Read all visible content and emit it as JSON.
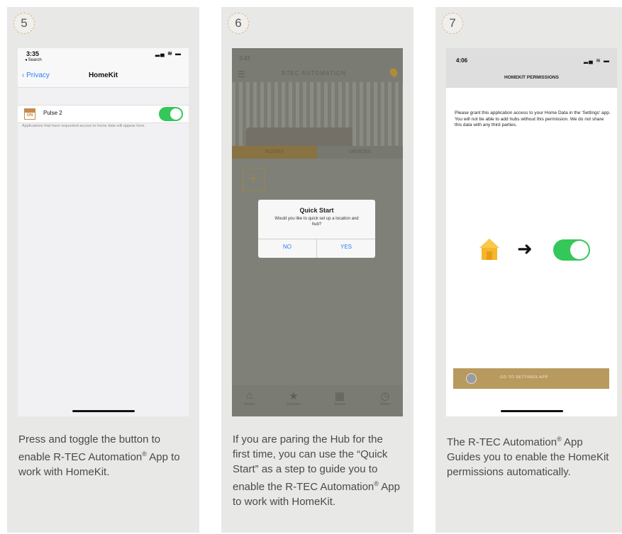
{
  "steps": [
    {
      "number": "5",
      "caption_parts": [
        "Press and toggle the button to enable R-TEC Automation",
        "®",
        " App to work with HomeKit."
      ]
    },
    {
      "number": "6",
      "caption_parts": [
        "If you are paring the Hub for the first time, you can use the “Quick Start” as a step to guide you to enable the R-TEC Automation",
        "®",
        " App to work with HomeKit."
      ]
    },
    {
      "number": "7",
      "caption_parts": [
        "The R-TEC Automation",
        "®",
        " App Guides you to enable the HomeKit permissions automatically."
      ]
    }
  ],
  "phone1": {
    "time": "3:35",
    "back_search": "◂ Search",
    "back_label": "Privacy",
    "title": "HomeKit",
    "app_icon_text": "ON",
    "app_name": "Pulse 2",
    "toggle_on": true,
    "note": "Applications that have requested access to home data will appear here."
  },
  "phone2": {
    "time": "3:43",
    "logo": "RTEC AUTOMATION",
    "tab_active": "ROOMS",
    "tab_inactive": "DEVICES",
    "dialog": {
      "title": "Quick Start",
      "message": "Would you like to quick set up a location and hub?",
      "no_label": "NO",
      "yes_label": "YES"
    },
    "nav": [
      "Rooms",
      "Favorites",
      "Scenes",
      "Timers"
    ]
  },
  "phone3": {
    "time": "4:06",
    "title": "HOMEKIT PERMISSIONS",
    "message": "Please grant this application access to your Home Data in the 'Settings' app. You will not be able to add hubs without this permission. We do not share this data with any third parties.",
    "button_label": "GO TO SETTINGS APP"
  },
  "colors": {
    "accent": "#34c759",
    "brand": "#b89a5f",
    "link": "#2e7cf6"
  }
}
